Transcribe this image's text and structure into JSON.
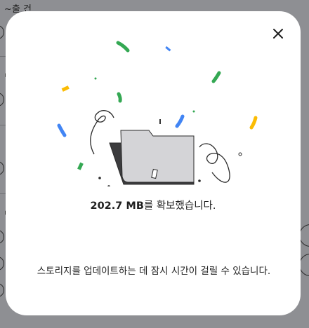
{
  "background": {
    "fragments": [
      "~출 건",
      "및",
      "ㄷ",
      "방"
    ]
  },
  "dialog": {
    "close_label": "×",
    "freed_size": "202.7 MB",
    "freed_suffix": "를 확보했습니다.",
    "update_message": "스토리지를 업데이트하는 데 잠시 시간이 걸릴 수 있습니다."
  },
  "colors": {
    "overlay": "#8e8f93",
    "dialog_bg": "#ffffff",
    "confetti_green": "#34a853",
    "confetti_blue": "#4285f4",
    "confetti_yellow": "#fbbc04",
    "folder_back": "#3c3c3e",
    "folder_front": "#d4d4d7"
  },
  "icons": {
    "close": "close-icon",
    "illustration": "cleared-folder-illustration"
  }
}
